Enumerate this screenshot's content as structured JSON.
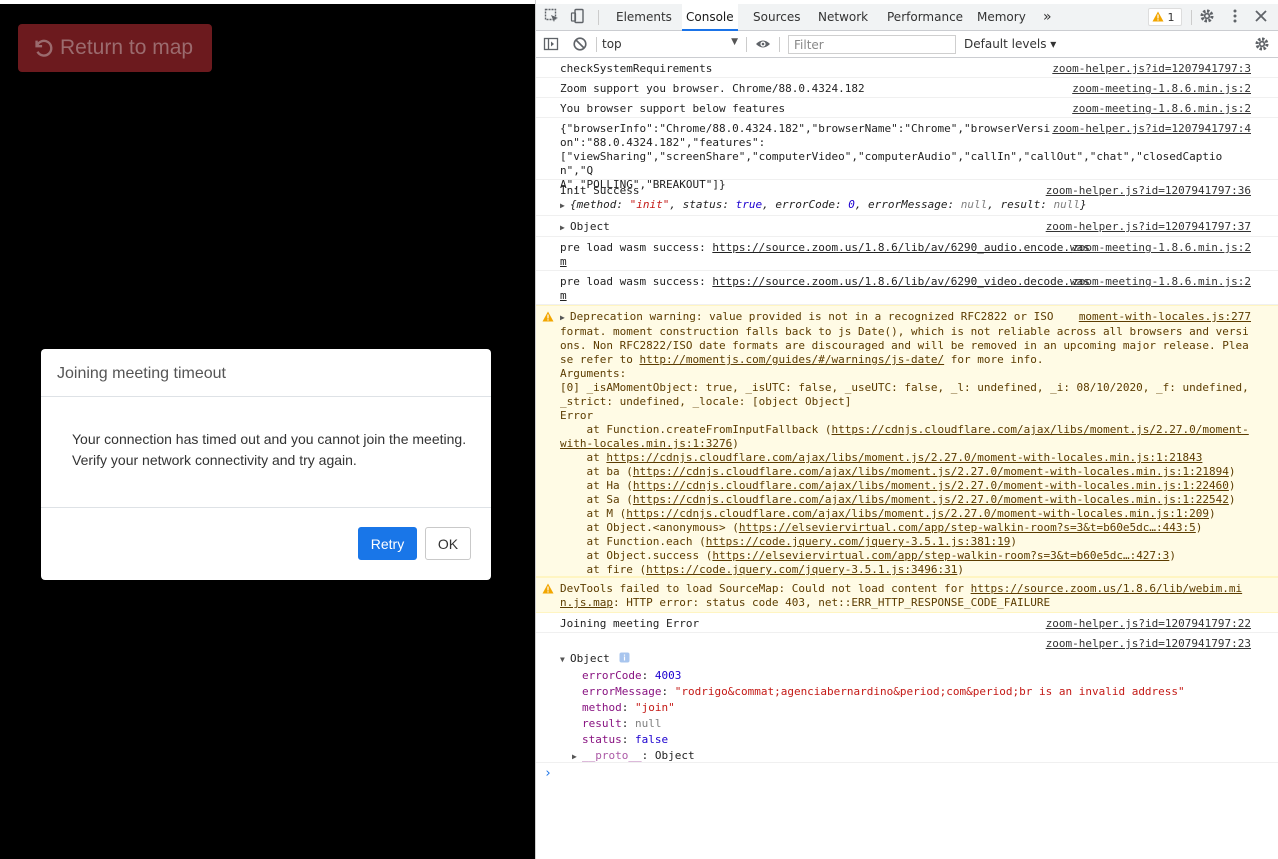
{
  "app": {
    "return_label": "Return to map",
    "modal": {
      "title": "Joining meeting timeout",
      "body": "Your connection has timed out and you cannot join the meeting. Verify your network connectivity and try again.",
      "retry": "Retry",
      "ok": "OK"
    }
  },
  "devtools": {
    "tabs": [
      "Elements",
      "Console",
      "Sources",
      "Network",
      "Performance",
      "Memory"
    ],
    "more_tabs": "»",
    "warning_count": "1",
    "context": "top",
    "filter_placeholder": "Filter",
    "levels": "Default levels ▾",
    "messages": [
      {
        "text": "checkSystemRequirements",
        "src": "zoom-helper.js?id=1207941797:3"
      },
      {
        "text": "Zoom support you browser. Chrome/88.0.4324.182",
        "src": "zoom-meeting-1.8.6.min.js:2"
      },
      {
        "text": "You browser support below features",
        "src": "zoom-meeting-1.8.6.min.js:2"
      },
      {
        "text": "{\"browserInfo\":\"Chrome/88.0.4324.182\",\"browserName\":\"Chrome\",\"browserVersi\non\":\"88.0.4324.182\",\"features\":\n[\"viewSharing\",\"screenShare\",\"computerVideo\",\"computerAudio\",\"callIn\",\"callOut\",\"chat\",\"closedCaption\",\"Q\nA\",\"POLLING\",\"BREAKOUT\"]}",
        "src": "zoom-helper.js?id=1207941797:4"
      },
      {
        "text": "Init Success",
        "src": "zoom-helper.js?id=1207941797:36",
        "sub": "{method: \"init\", status: true, errorCode: 0, errorMessage: null, result: null}"
      },
      {
        "text": "Object",
        "src": "zoom-helper.js?id=1207941797:37"
      },
      {
        "text": "pre load wasm success: ",
        "link": "https://source.zoom.us/1.8.6/lib/av/6290_audio.encode.wasm",
        "src": "zoom-meeting-1.8.6.min.js:2"
      },
      {
        "text": "pre load wasm success: ",
        "link": "https://source.zoom.us/1.8.6/lib/av/6290_video.decode.wasm",
        "src": "zoom-meeting-1.8.6.min.js:2"
      }
    ],
    "deprecation": {
      "src": "moment-with-locales.js:277",
      "line1": "Deprecation warning: value provided is not in a recognized RFC2822 or ISO",
      "line2": "format. moment construction falls back to js Date(), which is not reliable across all browsers and versions. Non RFC2822/ISO date formats are discouraged and will be removed in an upcoming major release. Please refer to ",
      "link": "http://momentjs.com/guides/#/warnings/js-date/",
      "line3": " for more info.",
      "args": "Arguments:\n[0] _isAMomentObject: true, _isUTC: false, _useUTC: false, _l: undefined, _i: 08/10/2020, _f: undefined, _strict: undefined, _locale: [object Object]\nError",
      "stack": [
        {
          "pre": "    at Function.createFromInputFallback (",
          "url": "https://cdnjs.cloudflare.com/ajax/libs/moment.js/2.27.0/moment-with-locales.min.js:1:3276",
          "post": ")"
        },
        {
          "pre": "    at ",
          "url": "https://cdnjs.cloudflare.com/ajax/libs/moment.js/2.27.0/moment-with-locales.min.js:1:21843",
          "post": ""
        },
        {
          "pre": "    at ba (",
          "url": "https://cdnjs.cloudflare.com/ajax/libs/moment.js/2.27.0/moment-with-locales.min.js:1:21894",
          "post": ")"
        },
        {
          "pre": "    at Ha (",
          "url": "https://cdnjs.cloudflare.com/ajax/libs/moment.js/2.27.0/moment-with-locales.min.js:1:22460",
          "post": ")"
        },
        {
          "pre": "    at Sa (",
          "url": "https://cdnjs.cloudflare.com/ajax/libs/moment.js/2.27.0/moment-with-locales.min.js:1:22542",
          "post": ")"
        },
        {
          "pre": "    at M (",
          "url": "https://cdnjs.cloudflare.com/ajax/libs/moment.js/2.27.0/moment-with-locales.min.js:1:209",
          "post": ")"
        },
        {
          "pre": "    at Object.<anonymous> (",
          "url": "https://elseviervirtual.com/app/step-walkin-room?s=3&t=b60e5dc…:443:5",
          "post": ")"
        },
        {
          "pre": "    at Function.each (",
          "url": "https://code.jquery.com/jquery-3.5.1.js:381:19",
          "post": ")"
        },
        {
          "pre": "    at Object.success (",
          "url": "https://elseviervirtual.com/app/step-walkin-room?s=3&t=b60e5dc…:427:3",
          "post": ")"
        },
        {
          "pre": "    at fire (",
          "url": "https://code.jquery.com/jquery-3.5.1.js:3496:31",
          "post": ")"
        }
      ]
    },
    "sourcemap": {
      "pre": "DevTools failed to load SourceMap: Could not load content for ",
      "url": "https://source.zoom.us/1.8.6/lib/webim.min.js.map",
      "post": ": HTTP error: status code 403, net::ERR_HTTP_RESPONSE_CODE_FAILURE"
    },
    "join_error": {
      "text": "Joining meeting Error",
      "src": "zoom-helper.js?id=1207941797:22"
    },
    "object_src": "zoom-helper.js?id=1207941797:23",
    "object": {
      "label": "Object",
      "errorCode": "4003",
      "errorMessage": "\"rodrigo&commat;agenciabernardino&period;com&period;br is an invalid address\"",
      "method": "\"join\"",
      "result": "null",
      "status": "false",
      "proto": "Object"
    },
    "prompt": "›"
  }
}
